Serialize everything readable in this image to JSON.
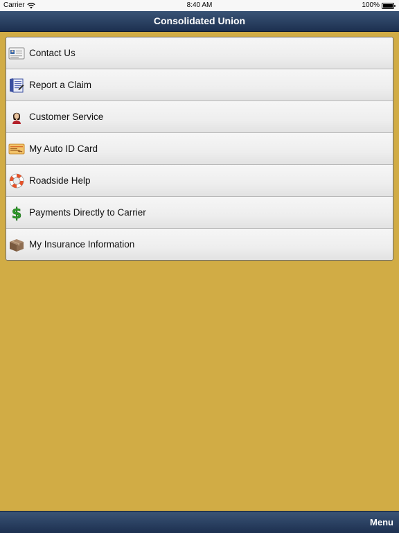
{
  "status_bar": {
    "carrier": "Carrier",
    "time": "8:40 AM",
    "battery": "100%"
  },
  "nav": {
    "title": "Consolidated Union"
  },
  "menu": {
    "items": [
      {
        "label": "Contact Us",
        "icon": "contact-card-icon"
      },
      {
        "label": "Report a Claim",
        "icon": "claim-document-icon"
      },
      {
        "label": "Customer Service",
        "icon": "service-agent-icon"
      },
      {
        "label": "My Auto ID Card",
        "icon": "id-card-icon"
      },
      {
        "label": "Roadside Help",
        "icon": "lifebuoy-icon"
      },
      {
        "label": "Payments Directly to Carrier",
        "icon": "dollar-sign-icon"
      },
      {
        "label": "My Insurance Information",
        "icon": "box-icon"
      }
    ]
  },
  "bottom_bar": {
    "menu_label": "Menu"
  },
  "colors": {
    "background": "#d1ac45",
    "bar_top": "#3a5476",
    "bar_bottom": "#1d3050"
  }
}
